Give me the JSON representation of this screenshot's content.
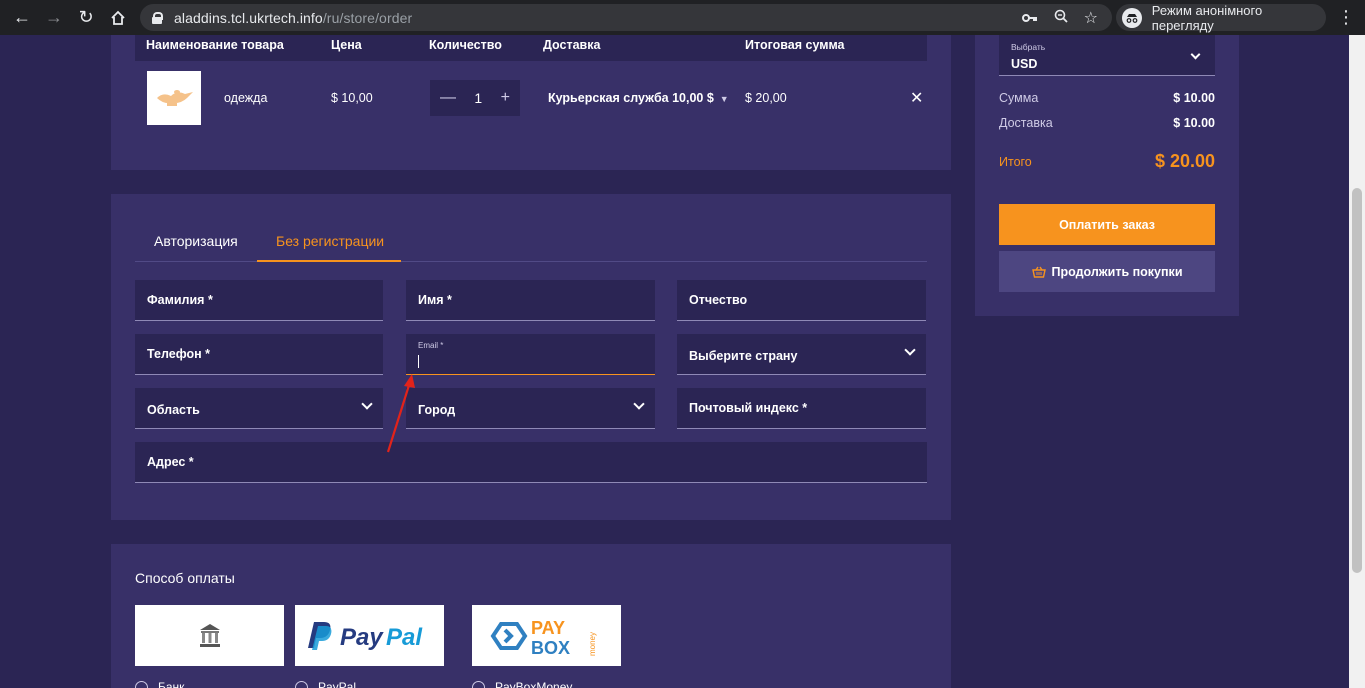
{
  "browser": {
    "url_domain": "aladdins.tcl.ukrtech.info",
    "url_path": "/ru/store/order",
    "incognito_label": "Режим анонімного перегляду"
  },
  "cart": {
    "headers": [
      "Наименование товара",
      "Цена",
      "Количество",
      "Доставка",
      "Итоговая сумма"
    ],
    "item": {
      "name": "одежда",
      "price": "$ 10,00",
      "quantity": "1",
      "delivery": "Курьерская служба 10,00 $",
      "total": "$ 20,00"
    }
  },
  "form": {
    "tabs": [
      "Авторизация",
      "Без регистрации"
    ],
    "active_tab": "Без регистрации",
    "fields": {
      "last_name": "Фамилия *",
      "first_name": "Имя *",
      "middle_name": "Отчество",
      "phone": "Телефон *",
      "email": "Email *",
      "country": "Выберите страну",
      "region": "Область",
      "city": "Город",
      "postal": "Почтовый индекс *",
      "address": "Адрес *"
    }
  },
  "payment": {
    "title": "Способ оплаты",
    "options": [
      {
        "label": "Банк",
        "logo": "bank-icon"
      },
      {
        "label": "PayPal",
        "logo": "paypal-logo"
      },
      {
        "label": "PayBoxMoney",
        "logo": "paybox-logo"
      }
    ]
  },
  "summary": {
    "currency_label": "Выбрать",
    "currency": "USD",
    "sum_label": "Сумма",
    "sum_value": "$ 10.00",
    "delivery_label": "Доставка",
    "delivery_value": "$ 10.00",
    "total_label": "Итого",
    "total_value": "$ 20.00",
    "pay_button": "Оплатить заказ",
    "continue_button": "Продолжить покупки"
  },
  "colors": {
    "accent": "#f7931e",
    "background": "#2b2554",
    "card": "#383068",
    "arrow": "#e2231a"
  }
}
